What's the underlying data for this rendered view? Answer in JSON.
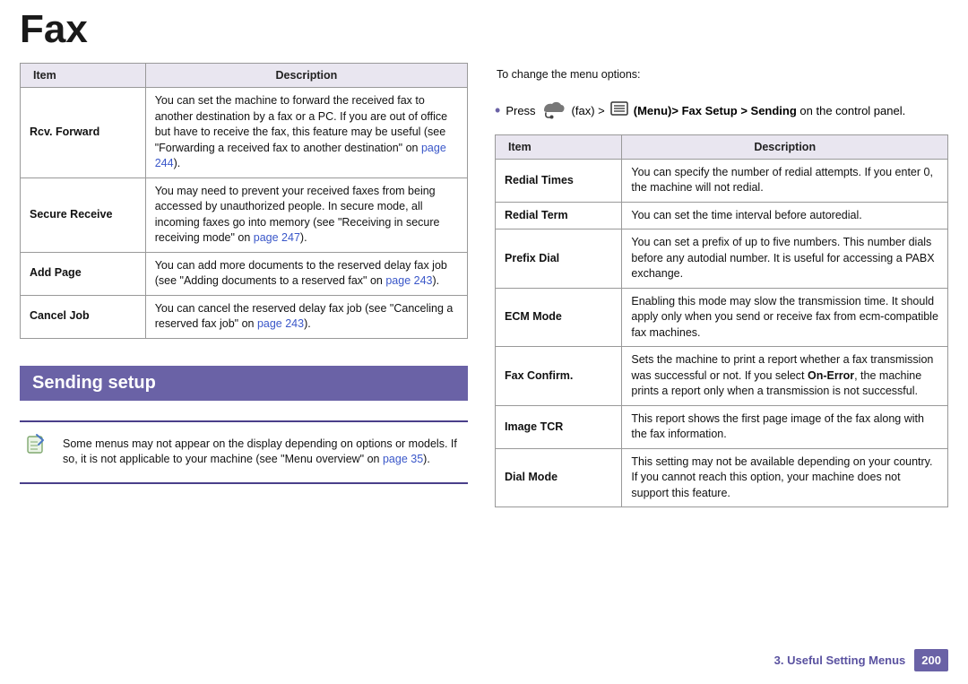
{
  "title": "Fax",
  "left_table": {
    "headers": {
      "item": "Item",
      "desc": "Description"
    },
    "rows": [
      {
        "item": "Rcv. Forward",
        "desc_parts": [
          "You can set the machine to forward the received fax to another destination by a fax or a PC. If you are out of office but have to receive the fax, this feature may be useful (see \"Forwarding a received fax to another destination\" on ",
          "page 244",
          ")."
        ]
      },
      {
        "item": "Secure Receive",
        "desc_parts": [
          "You may need to prevent your received faxes from being accessed by unauthorized people. In secure mode, all incoming faxes go into memory (see \"Receiving in secure receiving mode\" on ",
          "page 247",
          ")."
        ]
      },
      {
        "item": "Add Page",
        "desc_parts": [
          "You can add more documents to the reserved delay fax job (see \"Adding documents to a reserved fax\" on ",
          "page 243",
          ")."
        ]
      },
      {
        "item": "Cancel Job",
        "desc_parts": [
          "You can cancel the reserved delay fax job (see \"Canceling a reserved fax job\" on ",
          "page 243",
          ")."
        ]
      }
    ]
  },
  "section_header": "Sending setup",
  "left_note": [
    "Some menus may not appear on the display depending on options or models. If so, it is not applicable to your machine (see \"Menu overview\" on ",
    "page 35",
    ")."
  ],
  "right_top_note": "To change the menu options:",
  "instruction": {
    "bullet": "•",
    "press": "Press",
    "fax_label": "(fax) >",
    "menu_word": "(Menu)",
    "path": "> Fax Setup > Sending",
    "tail": "on the control panel."
  },
  "right_table": {
    "headers": {
      "item": "Item",
      "desc": "Description"
    },
    "rows": [
      {
        "item": "Redial Times",
        "desc": "You can specify the number of redial attempts. If you enter 0, the machine will not redial."
      },
      {
        "item": "Redial Term",
        "desc": "You can set the time interval before autoredial."
      },
      {
        "item": "Prefix Dial",
        "desc": "You can set a prefix of up to five numbers. This number dials before any autodial number. It is useful for accessing a PABX exchange."
      },
      {
        "item": "ECM Mode",
        "desc": "Enabling this mode may slow the transmission time. It should apply only when you send or receive fax from ecm-compatible fax machines."
      },
      {
        "item": "Fax Confirm.",
        "desc_parts": [
          "Sets the machine to print a report whether a fax transmission was successful or not. If you select ",
          "On-Error",
          ", the machine prints a report only when a transmission is not successful."
        ]
      },
      {
        "item": "Image TCR",
        "desc": "This report shows the first page image of the fax along with the fax information."
      },
      {
        "item": "Dial Mode",
        "desc": "This setting may not be available depending on your country. If you cannot reach this option, your machine does not support this feature."
      }
    ]
  },
  "footer": {
    "chapter": "3.  Useful Setting Menus",
    "page": "200"
  }
}
